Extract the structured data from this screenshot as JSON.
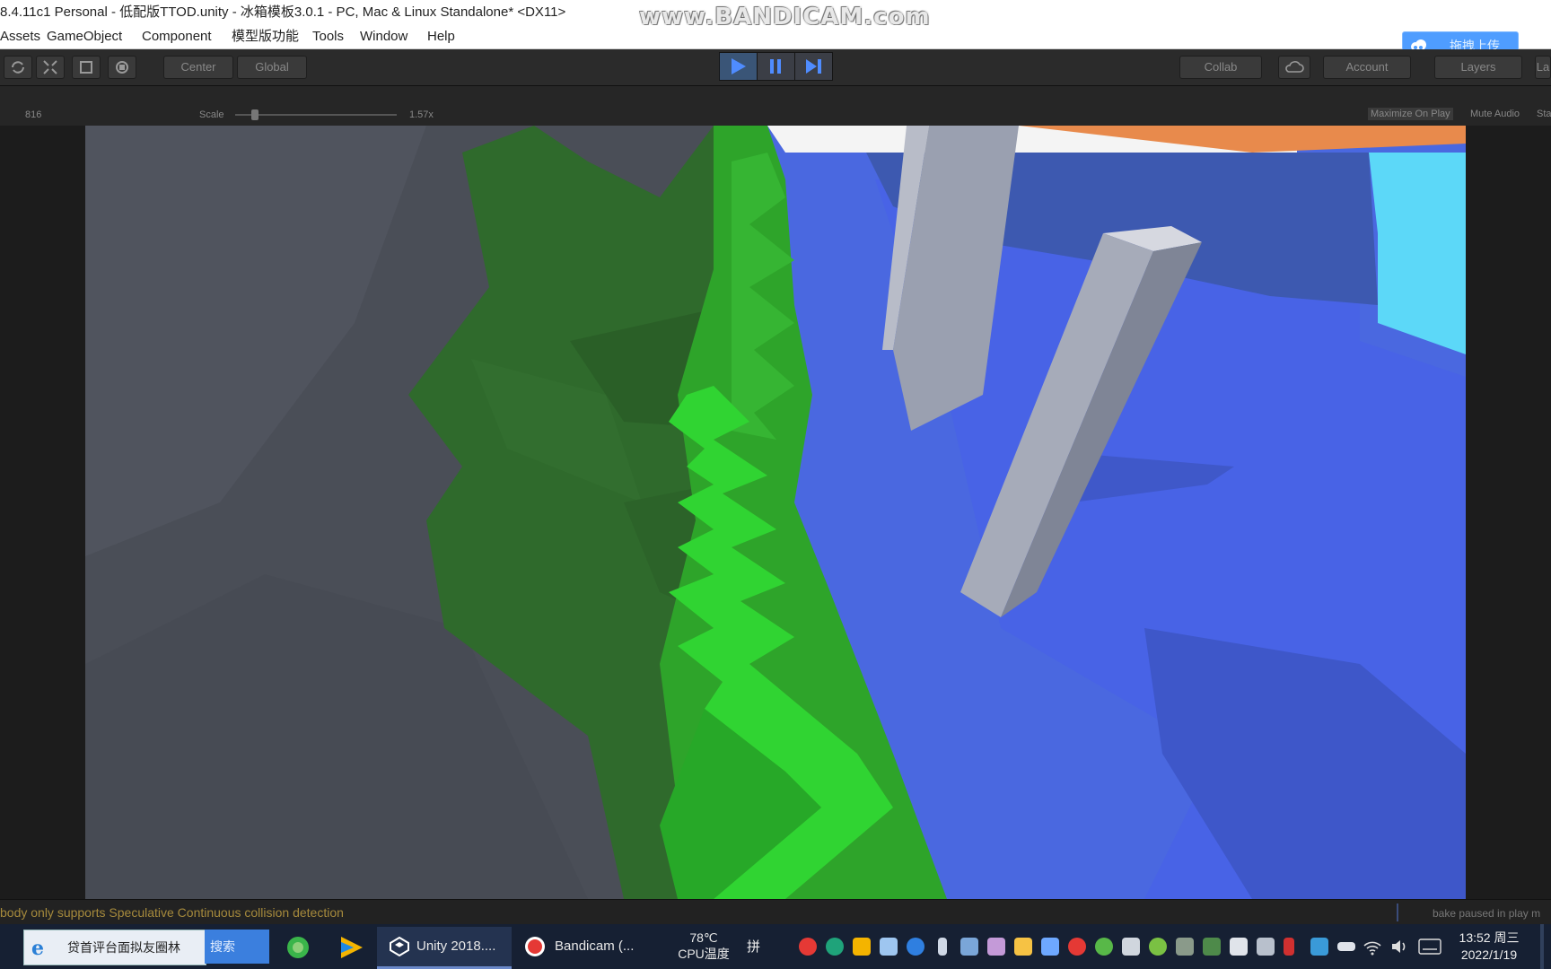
{
  "window": {
    "title": "8.4.11c1 Personal - 低配版TTOD.unity - 冰箱模板3.0.1 - PC, Mac & Linux Standalone* <DX11>",
    "watermark": "www.BANDICAM.com"
  },
  "menubar": {
    "items": [
      "Assets",
      "GameObject",
      "Component",
      "模型版功能",
      "Tools",
      "Window",
      "Help"
    ]
  },
  "upload": {
    "label": "拖拽上传"
  },
  "toolbar": {
    "pivot_label": "Center",
    "space_label": "Global",
    "collab_label": "Collab",
    "account_label": "Account",
    "layers_label": "Layers",
    "layout_label": "La"
  },
  "game_view": {
    "aspect_label": "816",
    "scale_label": "Scale",
    "scale_value": "1.57x",
    "maximize_label": "Maximize On Play",
    "mute_label": "Mute Audio",
    "stats_label": "Sta"
  },
  "statusbar": {
    "message": "body only supports Speculative Continuous collision detection",
    "right_text": "bake paused in play m"
  },
  "taskbar": {
    "browser_text": "贷首评台面拟友圈林",
    "search_label": "搜索",
    "apps": [
      {
        "label": "Unity 2018...."
      },
      {
        "label": "Bandicam (..."
      }
    ],
    "cpu_temp": "78℃",
    "cpu_label": "CPU温度",
    "ime_label": "拼",
    "clock_time": "13:52 周三",
    "clock_date": "2022/1/19"
  },
  "colors": {
    "water": "#4a68e0",
    "sky": "#5cd8f8",
    "dark_green": "#2f6a2c",
    "bright_green": "#2ec12e",
    "pillar": "#9aa0b0",
    "rock": "#4a4e57",
    "accent": "#4f9dff"
  }
}
